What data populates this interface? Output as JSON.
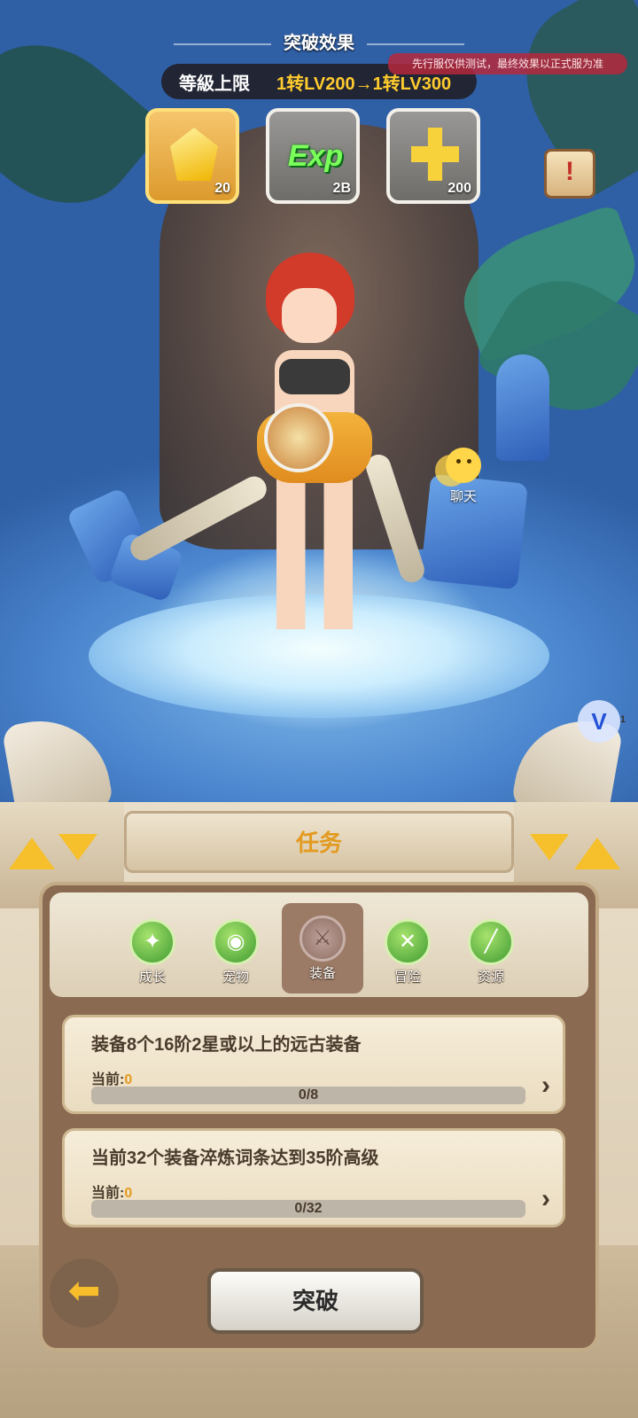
{
  "breakthrough": {
    "title": "突破效果",
    "level_cap_label": "等級上限",
    "level_cap_value": "1转LV200→1转LV300",
    "notice": "先行服仅供测试，最终效果以正式服为准",
    "rewards": [
      {
        "icon": "gold-crystal-icon",
        "qty": "20",
        "selected": true
      },
      {
        "icon": "exp-icon",
        "text": "Exp",
        "qty": "2B",
        "selected": false
      },
      {
        "icon": "gold-plus-icon",
        "qty": "200",
        "selected": false
      }
    ]
  },
  "chat": {
    "label": "聊天"
  },
  "v_badge": {
    "text": "V",
    "count": "1"
  },
  "panel": {
    "title": "任务",
    "tabs": [
      {
        "label": "成长",
        "icon": "growth-icon",
        "active": false
      },
      {
        "label": "宠物",
        "icon": "pet-icon",
        "active": false
      },
      {
        "label": "装备",
        "icon": "equipment-icon",
        "active": true
      },
      {
        "label": "冒险",
        "icon": "adventure-icon",
        "active": false
      },
      {
        "label": "资源",
        "icon": "bone-resource-icon",
        "active": false
      }
    ],
    "tasks": [
      {
        "title": "装备8个16阶2星或以上的远古装备",
        "current_label": "当前:",
        "current_value": "0",
        "progress_text": "0/8",
        "progress": 0
      },
      {
        "title": "当前32个装备淬炼词条达到35阶高级",
        "current_label": "当前:",
        "current_value": "0",
        "progress_text": "0/32",
        "progress": 0
      }
    ],
    "break_button": "突破"
  }
}
